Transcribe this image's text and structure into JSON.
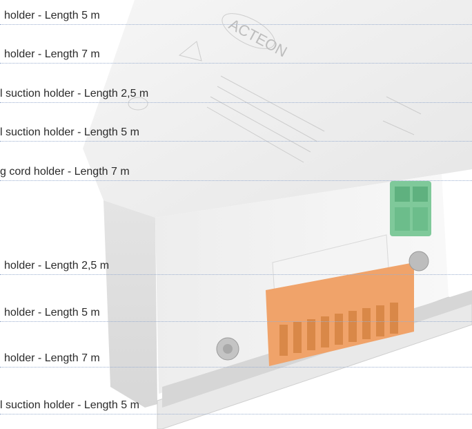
{
  "product_image": {
    "alt_icon": "controller-box-photo",
    "brand": "ACTEON"
  },
  "list": {
    "items": [
      {
        "label": "holder - Length 5 m"
      },
      {
        "label": "holder - Length 7 m"
      },
      {
        "label": "l  suction holder - Length 2,5 m"
      },
      {
        "label": "l  suction holder - Length 5 m"
      },
      {
        "label": "g cord holder - Length 7 m"
      },
      {
        "label": "holder - Length 2,5 m"
      },
      {
        "label": "holder - Length 5 m"
      },
      {
        "label": "holder - Length 7 m"
      },
      {
        "label": "l  suction holder - Length 5 m"
      }
    ]
  },
  "colors": {
    "divider": "#9aaecf",
    "text": "#2a2a2a",
    "terminal_orange": "#f0a36a",
    "terminal_green": "#7fc99a"
  }
}
